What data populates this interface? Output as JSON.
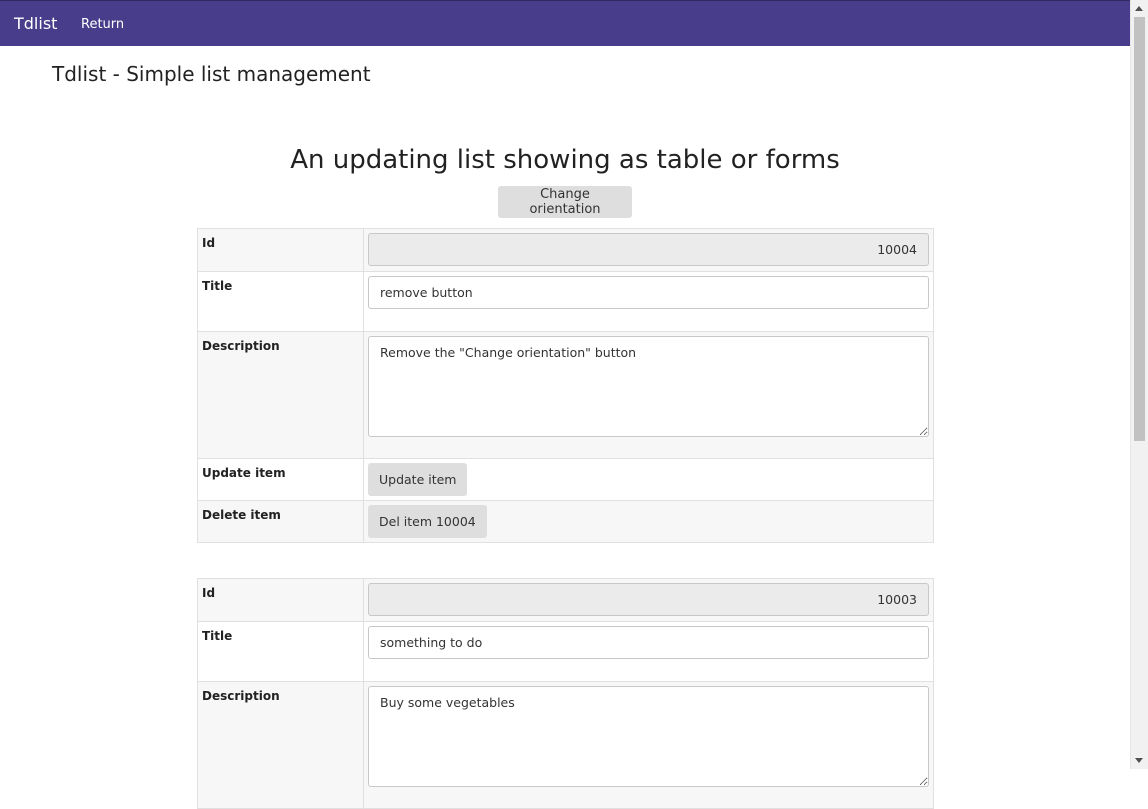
{
  "navbar": {
    "brand": "Tdlist",
    "return_label": "Return"
  },
  "page_title": "Tdlist - Simple list management",
  "heading": "An updating list showing as table or forms",
  "orientation_button": "Change orientation",
  "labels": {
    "id": "Id",
    "title": "Title",
    "description": "Description",
    "update": "Update item",
    "delete": "Delete item"
  },
  "items": [
    {
      "id": "10004",
      "title": "remove button",
      "description": "Remove the \"Change orientation\" button",
      "update_button": "Update item",
      "delete_button": "Del item 10004"
    },
    {
      "id": "10003",
      "title": "something to do",
      "description": "Buy some vegetables"
    }
  ]
}
